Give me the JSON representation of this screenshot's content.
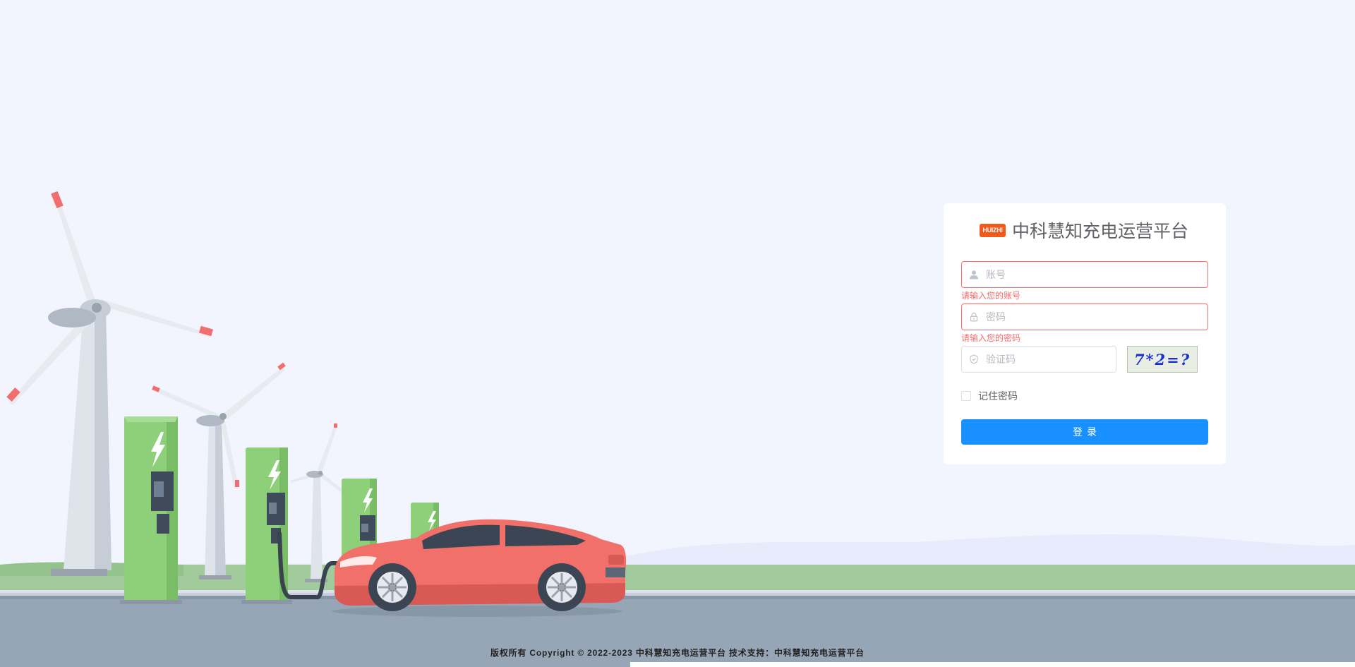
{
  "brand": {
    "logo_text": "HUIZHI",
    "title": "中科慧知充电运营平台",
    "accent_color": "#f25a1c"
  },
  "form": {
    "account": {
      "placeholder": "账号",
      "value": "",
      "icon": "user-icon",
      "error": "请输入您的账号"
    },
    "password": {
      "placeholder": "密码",
      "value": "",
      "icon": "lock-icon",
      "error": "请输入您的密码"
    },
    "captcha": {
      "placeholder": "验证码",
      "value": "",
      "icon": "shield-icon",
      "image_text": "7*2=?"
    },
    "remember_label": "记住密码",
    "remember_checked": false,
    "submit_label": "登录"
  },
  "footer": {
    "text": "版权所有 Copyright © 2022-2023 中科慧知充电运营平台 技术支持：中科慧知充电运营平台"
  },
  "colors": {
    "primary": "#1890ff",
    "error": "#f56c6c",
    "background": "#f3f5fe",
    "charger_green": "#8ecf7a",
    "car_red": "#f1716a"
  }
}
